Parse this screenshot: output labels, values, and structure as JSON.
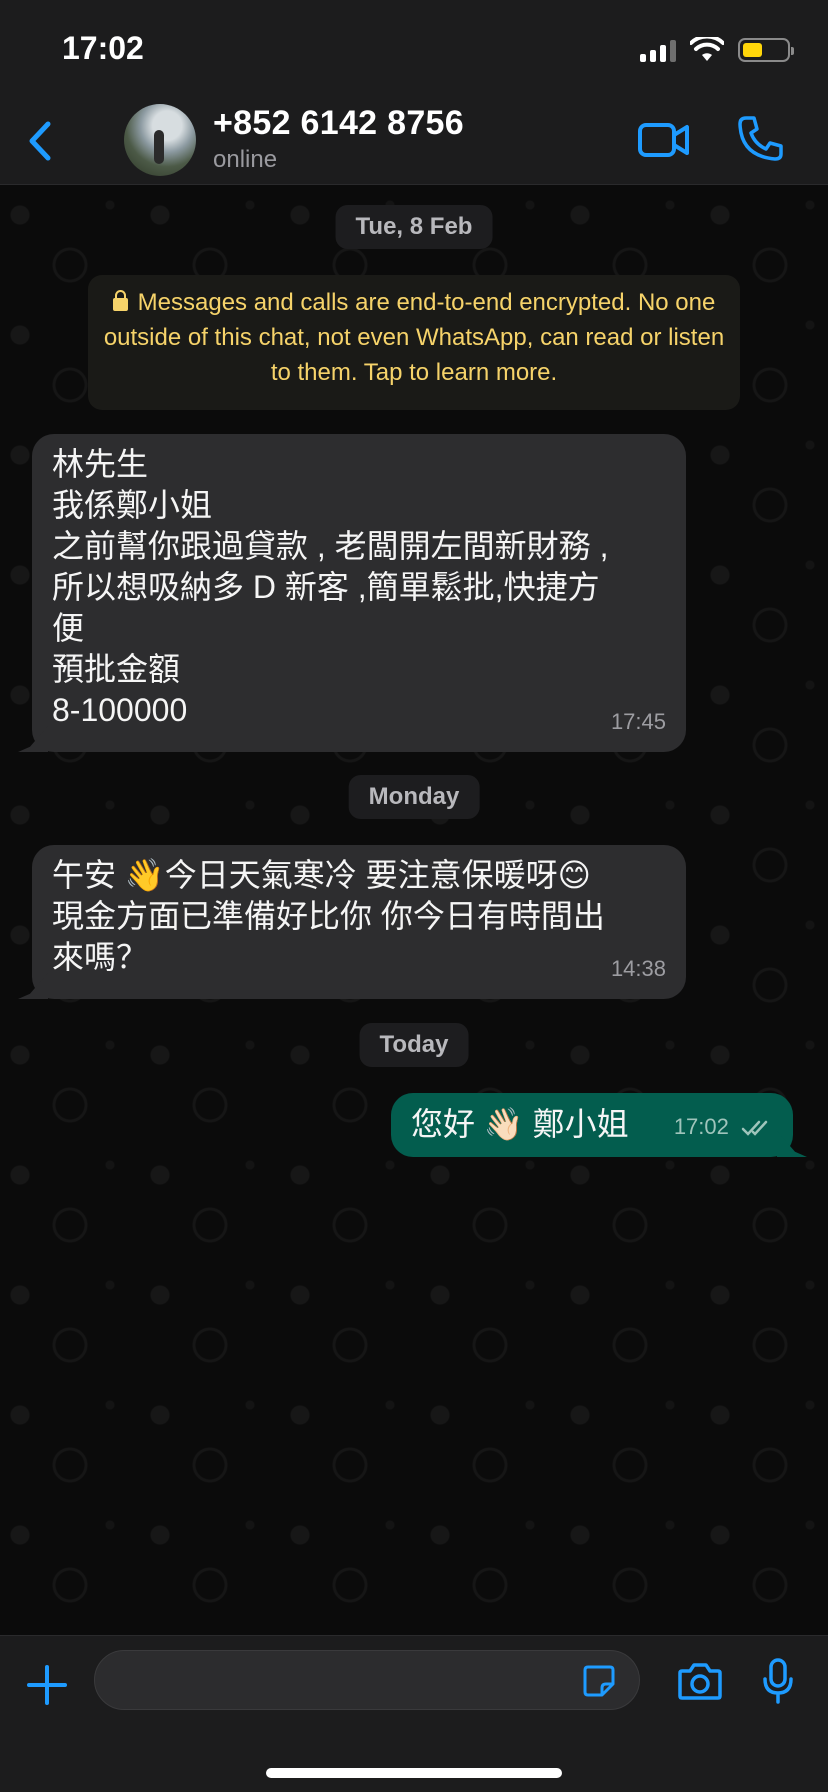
{
  "status_bar": {
    "time": "17:02",
    "battery_level": 0.45
  },
  "header": {
    "contact_name": "+852 6142 8756",
    "contact_status": "online",
    "accent_color": "#1e9bff"
  },
  "chat": {
    "date_1": "Tue, 8 Feb",
    "encryption_notice": "Messages and calls are end-to-end encrypted. No one outside of this chat, not even WhatsApp, can read or listen to them. Tap to learn more.",
    "messages": [
      {
        "direction": "in",
        "text": "林先生\n我係鄭小姐\n之前幫你跟過貸款 , 老闆開左間新財務 ,\n所以想吸納多 D 新客 ,簡單鬆批,快捷方\n便\n預批金額\n8-100000",
        "time": "17:45"
      },
      {
        "direction": "in",
        "text": "午安 👋今日天氣寒冷 要注意保暖呀😊\n現金方面已準備好比你 你今日有時間出\n來嗎？",
        "time": "14:38"
      },
      {
        "direction": "out",
        "text": "您好 👋🏻 鄭小姐",
        "time": "17:02"
      }
    ],
    "date_2": "Monday",
    "date_3": "Today"
  },
  "composer": {
    "placeholder": ""
  }
}
